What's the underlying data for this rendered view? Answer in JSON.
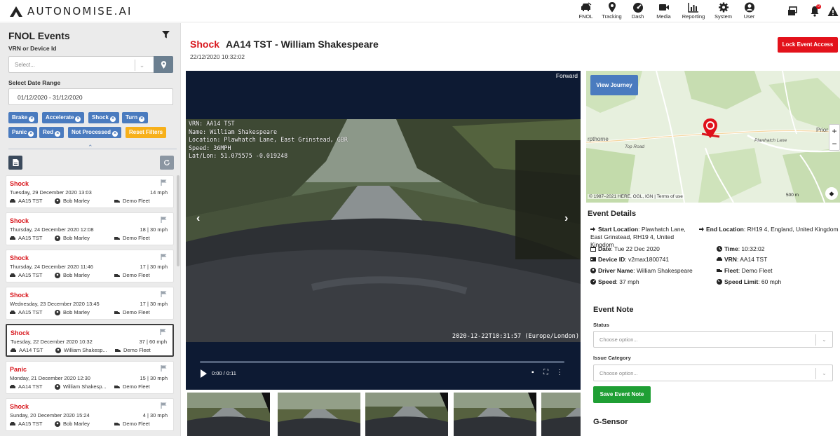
{
  "brand": {
    "name": "AUTONOMISE.AI"
  },
  "nav": {
    "items": [
      {
        "label": "FNOL",
        "icon": "car-crash-icon"
      },
      {
        "label": "Tracking",
        "icon": "map-marker-icon"
      },
      {
        "label": "Dash",
        "icon": "dashboard-icon"
      },
      {
        "label": "Media",
        "icon": "video-camera-icon"
      },
      {
        "label": "Reporting",
        "icon": "bar-chart-icon"
      },
      {
        "label": "System",
        "icon": "cog-icon"
      },
      {
        "label": "User",
        "icon": "user-circle-icon"
      }
    ],
    "notification_count": "0"
  },
  "sidebar": {
    "title": "FNOL Events",
    "vrn_label": "VRN or Device Id",
    "vrn_placeholder": "Select...",
    "date_label": "Select Date Range",
    "date_value": "01/12/2020 - 31/12/2020",
    "filters": [
      "Brake",
      "Accelerate",
      "Shock",
      "Turn",
      "Panic",
      "Red",
      "Not Processed"
    ],
    "reset_label": "Reset Filters",
    "events": [
      {
        "type": "Shock",
        "date": "Tuesday, 29 December 2020 13:03",
        "speed": "14 mph",
        "vrn": "AA15 TST",
        "driver": "Bob Marley",
        "fleet": "Demo Fleet"
      },
      {
        "type": "Shock",
        "date": "Thursday, 24 December 2020 12:08",
        "speed": "18 | 30 mph",
        "vrn": "AA15 TST",
        "driver": "Bob Marley",
        "fleet": "Demo Fleet"
      },
      {
        "type": "Shock",
        "date": "Thursday, 24 December 2020 11:46",
        "speed": "17 | 30 mph",
        "vrn": "AA15 TST",
        "driver": "Bob Marley",
        "fleet": "Demo Fleet"
      },
      {
        "type": "Shock",
        "date": "Wednesday, 23 December 2020 13:45",
        "speed": "17 | 30 mph",
        "vrn": "AA15 TST",
        "driver": "Bob Marley",
        "fleet": "Demo Fleet"
      },
      {
        "type": "Shock",
        "date": "Tuesday, 22 December 2020 10:32",
        "speed": "37 | 60 mph",
        "vrn": "AA14 TST",
        "driver": "William Shakesp...",
        "fleet": "Demo Fleet"
      },
      {
        "type": "Panic",
        "date": "Monday, 21 December 2020 12:30",
        "speed": "15 | 30 mph",
        "vrn": "AA14 TST",
        "driver": "William Shakesp...",
        "fleet": "Demo Fleet"
      },
      {
        "type": "Shock",
        "date": "Sunday, 20 December 2020 15:24",
        "speed": "4 | 30 mph",
        "vrn": "AA15 TST",
        "driver": "Bob Marley",
        "fleet": "Demo Fleet"
      }
    ]
  },
  "event": {
    "type": "Shock",
    "title": "AA14 TST - William Shakespeare",
    "datetime": "22/12/2020 10:32:02",
    "lock_label": "Lock Event Access"
  },
  "video": {
    "camera": "Forward",
    "osd": "VRN: AA14 TST\nName: William Shakespeare\nLocation: Plawhatch Lane, East Grinstead, GBR\nSpeed: 36MPH\nLat/Lon: 51.075575 -0.019248",
    "timestamp": "2020-12-22T10:31:57 (Europe/London)",
    "time_display": "0:00 / 0:11"
  },
  "map": {
    "view_journey_label": "View Journey",
    "place_label": "rpthorne",
    "road_label": "Top Road",
    "lane_label": "Plawhatch Lane",
    "town_label": "Prior",
    "copyright": "© 1987–2021 HERE, OGL, IGN | Terms of use",
    "scale": "500 m"
  },
  "details": {
    "title": "Event Details",
    "start_label": "Start Location",
    "start_value": "Plawhatch Lane, East Grinstead, RH19 4, United Kingdom",
    "end_label": "End Location",
    "end_value": "RH19 4, England, United Kingdom",
    "date_label": "Date",
    "date_value": "Tue 22 Dec 2020",
    "time_label": "Time",
    "time_value": "10:32:02",
    "device_label": "Device ID",
    "device_value": "v2max1800741",
    "vrn_label": "VRN",
    "vrn_value": "AA14 TST",
    "driver_label": "Driver Name",
    "driver_value": "William Shakespeare",
    "fleet_label": "Fleet",
    "fleet_value": "Demo Fleet",
    "speed_label": "Speed",
    "speed_value": "37 mph",
    "limit_label": "Speed Limit",
    "limit_value": "60 mph"
  },
  "note": {
    "title": "Event Note",
    "status_label": "Status",
    "status_placeholder": "Choose option...",
    "issue_label": "Issue Category",
    "issue_placeholder": "Choose option...",
    "save_label": "Save Event Note",
    "gsensor_title": "G-Sensor"
  },
  "colors": {
    "accent_red": "#d8171d",
    "button_blue": "#4a7bbf",
    "save_green": "#1f9f34",
    "reset_orange": "#f7b01a"
  }
}
